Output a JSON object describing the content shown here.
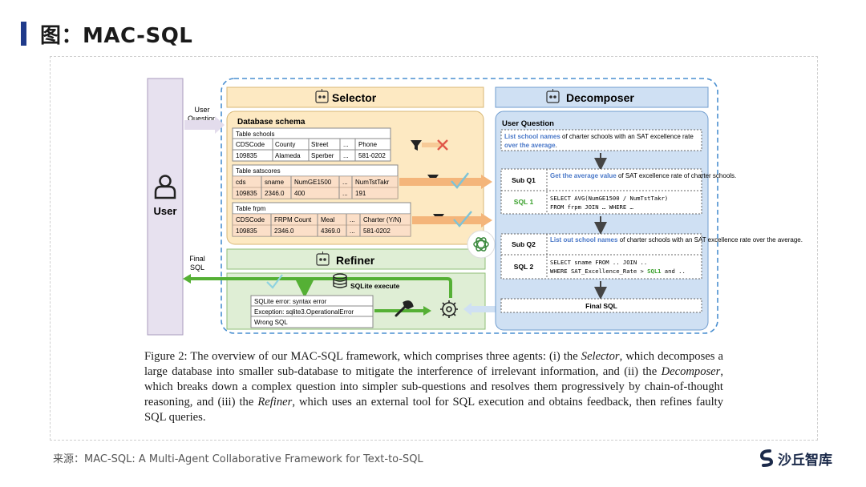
{
  "page": {
    "title": "图：MAC-SQL",
    "source": "来源：MAC-SQL: A Multi-Agent Collaborative Framework for Text-to-SQL",
    "logo_text": "沙丘智库"
  },
  "diagram": {
    "user_label": "User",
    "user_question_label": [
      "User",
      "Question"
    ],
    "final_sql_label": [
      "Final",
      "SQL"
    ],
    "selector": {
      "title": "Selector",
      "schema_title": "Database schema",
      "tables": [
        {
          "name": "Table schools",
          "headers": [
            "CDSCode",
            "County",
            "Street",
            "...",
            "Phone"
          ],
          "row": [
            "109835",
            "Alameda",
            "Sperber",
            "...",
            "581-0202"
          ]
        },
        {
          "name": "Table satscores",
          "headers": [
            "cds",
            "sname",
            "NumGE1500",
            "...",
            "NumTstTakr"
          ],
          "row": [
            "109835",
            "2346.0",
            "400",
            "...",
            "191"
          ]
        },
        {
          "name": "Table frpm",
          "headers": [
            "CDSCode",
            "FRPM Count",
            "Meal",
            "...",
            "Charter (Y/N)"
          ],
          "row": [
            "109835",
            "2346.0",
            "4369.0",
            "...",
            "581-0202"
          ]
        }
      ]
    },
    "refiner": {
      "title": "Refiner",
      "execute_label": "SQLite execute",
      "errors": [
        "SQLite error: syntax error",
        "Exception: sqlite3.OperationalError",
        "Wrong SQL"
      ]
    },
    "decomposer": {
      "title": "Decomposer",
      "question_label": "User Question",
      "question": {
        "hl1": "List school names",
        "t1": " of charter schools with an SAT excellence rate ",
        "hl2": "over the average",
        "t2": "."
      },
      "subq1_label": "Sub Q1",
      "subq1": {
        "hl": "Get the average value",
        "t": " of SAT excellence rate of charter schools."
      },
      "sql1_label": "SQL 1",
      "sql1": [
        "SELECT AVG(NumGE1500 / NumTstTakr)",
        "FROM frpm JOIN … WHERE …"
      ],
      "subq2_label": "Sub Q2",
      "subq2": {
        "hl": "List out school names",
        "t": " of charter schools with an SAT excellence rate over the average."
      },
      "sql2_label": "SQL 2",
      "sql2": [
        "SELECT sname FROM .. JOIN ..",
        "WHERE SAT_Excellence_Rate > ",
        "SQL1",
        " and .."
      ],
      "final_label": "Final SQL"
    },
    "caption": {
      "p1": "Figure 2: The overview of our MAC-SQL framework, which comprises three agents: (i) the ",
      "a1": "Selector",
      "p2": ", which decomposes a large database into smaller sub-database to mitigate the interference of irrelevant information, and (ii) the ",
      "a2": "Decomposer",
      "p3": ", which breaks down a complex question into simpler sub-questions and resolves them progressively by chain-of-thought reasoning, and (iii) the ",
      "a3": "Refiner",
      "p4": ", which uses an external tool for SQL execution and obtains feedback, then refines faulty SQL queries."
    }
  },
  "colors": {
    "accent": "#1f3a8a",
    "selector_fill": "#fde9c2",
    "refiner_fill": "#dfeed5",
    "decomposer_fill": "#cfe0f3",
    "user_fill": "#e7e1ef",
    "green": "#55b035",
    "orange": "#f4b57a",
    "highlight": "#4a78c8"
  }
}
